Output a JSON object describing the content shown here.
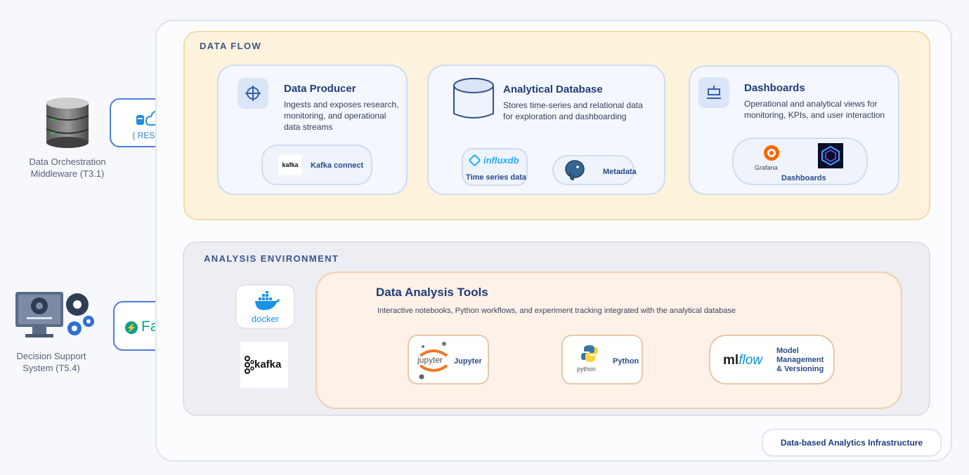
{
  "external": {
    "middleware_label": "Data Orchestration Middleware (T3.1)",
    "rest_api_label": "{ REST-API }",
    "dss_label": "Decision Support System (T5.4)",
    "fastapi_label": "FastAPI"
  },
  "data_flow": {
    "title": "DATA FLOW",
    "producer": {
      "title": "Data Producer",
      "desc": "Ingests and exposes research, monitoring, and operational data streams",
      "kafka_logo": "kafka",
      "connector_label": "Kafka connect"
    },
    "database": {
      "title": "Analytical Database",
      "desc": "Stores time-series and relational data for exploration and dashboarding",
      "influx_logo": "influxdb",
      "influx_label": "Time series data",
      "postgres_label": "Metadata"
    },
    "dashboards": {
      "title": "Dashboards",
      "desc": "Operational and analytical views for monitoring, KPIs, and user interaction",
      "grafana_label": "Grafana",
      "tools_label": "Dashboards"
    }
  },
  "analysis": {
    "title": "ANALYSIS ENVIRONMENT",
    "docker_label": "docker",
    "kafka_label": "kafka",
    "tools": {
      "title": "Data Analysis Tools",
      "desc": "Interactive notebooks, Python workflows, and experiment tracking integrated with the analytical database",
      "jupyter_logo": "jupyter",
      "jupyter_label": "Jupyter",
      "python_logo": "python",
      "python_label": "Python",
      "mlflow_logo_a": "ml",
      "mlflow_logo_b": "flow",
      "mlflow_label": "Model Management & Versioning"
    }
  },
  "footer_badge": "Data-based Analytics Infrastructure",
  "colors": {
    "flow_bg": "#fdf3dd",
    "analysis_bg": "#eceef3",
    "accent_blue": "#1f3c7a",
    "fastapi_green": "#0d9f88"
  }
}
